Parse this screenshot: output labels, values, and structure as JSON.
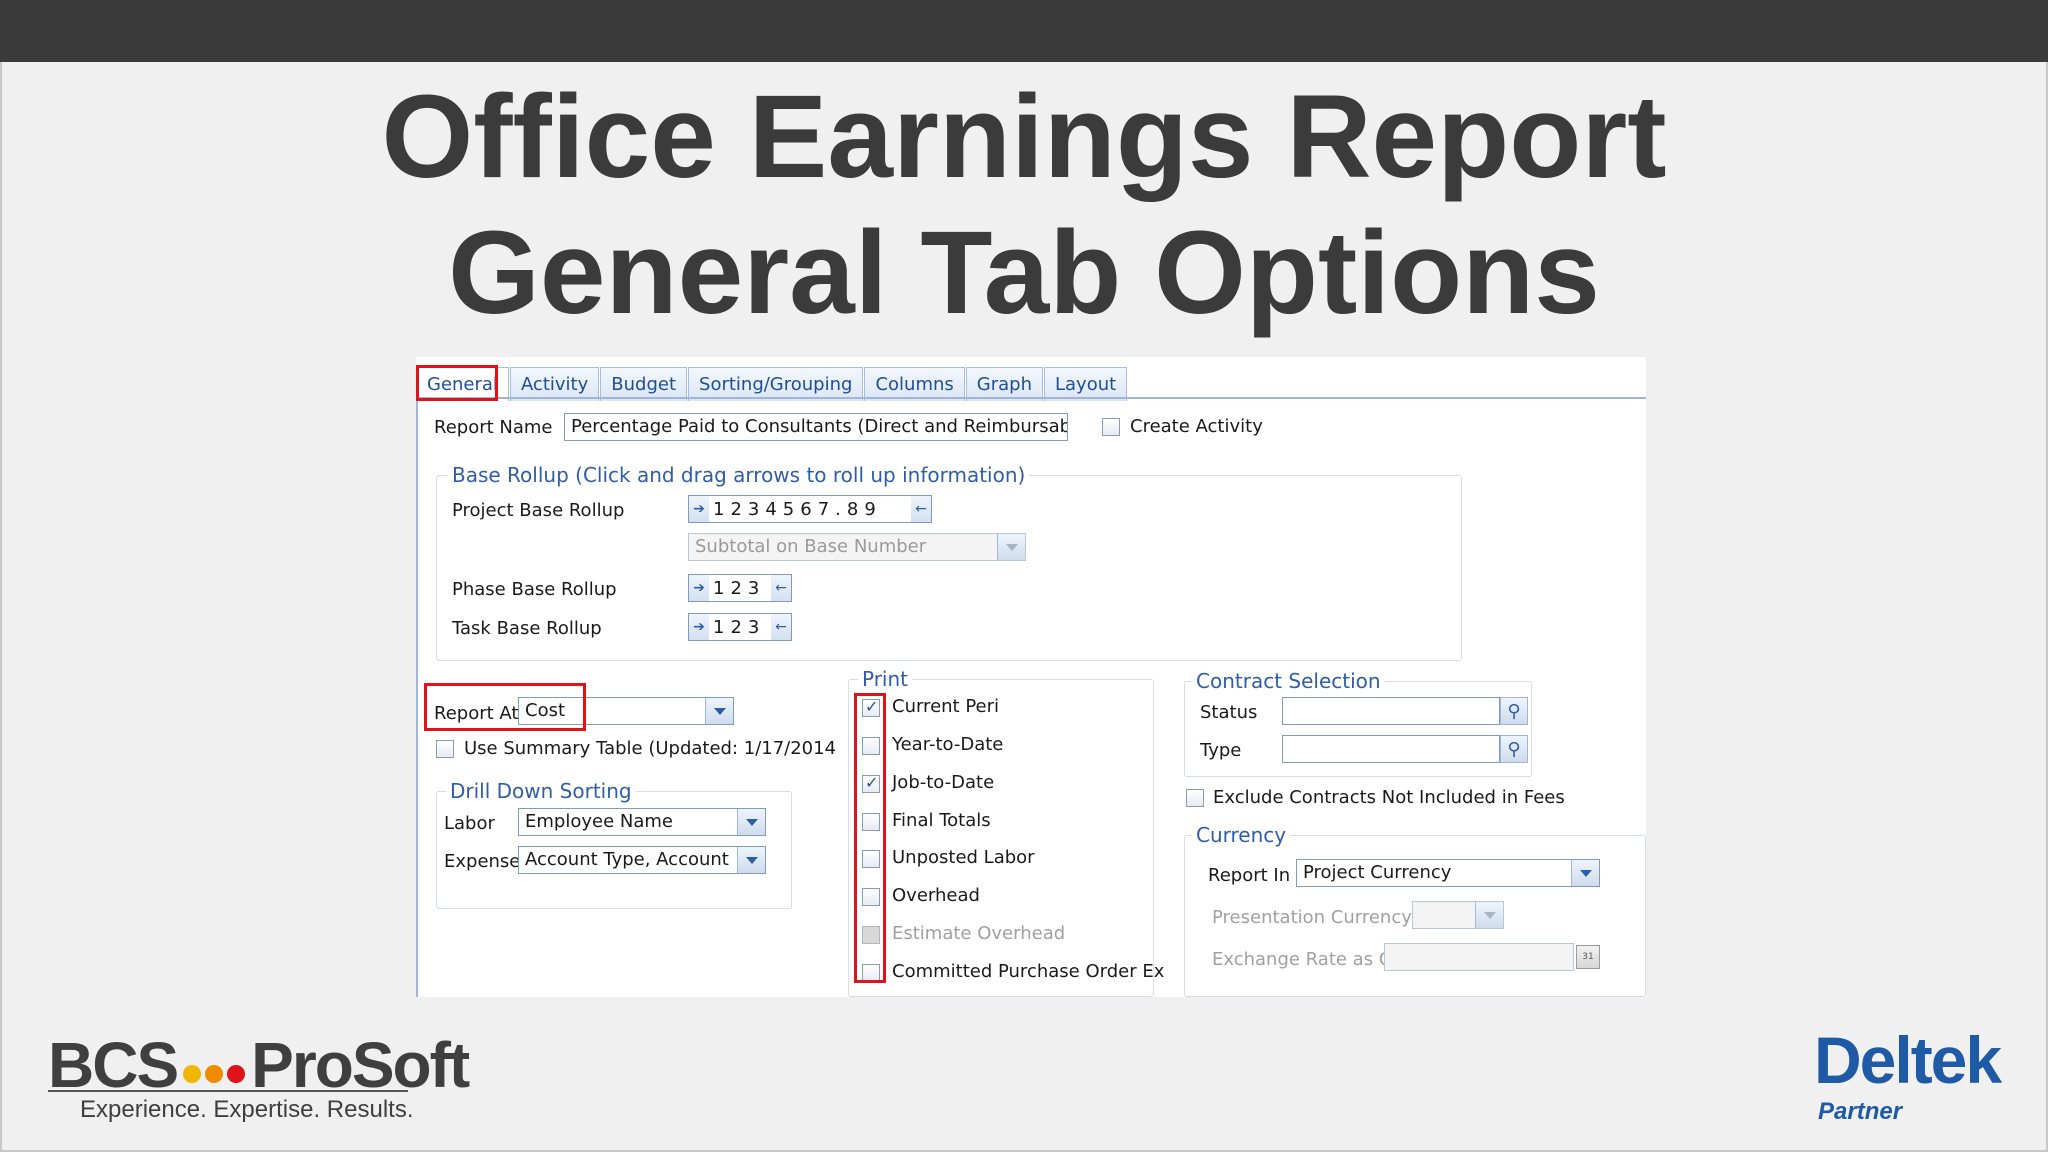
{
  "slide": {
    "title_line1": "Office Earnings Report",
    "title_line2": "General Tab Options"
  },
  "tabs": [
    "General",
    "Activity",
    "Budget",
    "Sorting/Grouping",
    "Columns",
    "Graph",
    "Layout"
  ],
  "general": {
    "report_name_label": "Report Name",
    "report_name_value": "Percentage Paid to Consultants (Direct and Reimbursabl",
    "create_activity_label": "Create Activity",
    "create_activity_checked": false,
    "base_rollup": {
      "group_title": "Base Rollup (Click and drag arrows to roll up information)",
      "project_label": "Project Base Rollup",
      "project_digits": "1234567.89",
      "subtotal_placeholder": "Subtotal on Base Number",
      "phase_label": "Phase Base Rollup",
      "phase_digits": "123",
      "task_label": "Task Base Rollup",
      "task_digits": "123"
    },
    "report_at_label": "Report At",
    "report_at_value": "Cost",
    "use_summary_label": "Use Summary Table (Updated: 1/17/2014",
    "drill_down": {
      "group_title": "Drill Down Sorting",
      "labor_label": "Labor",
      "labor_value": "Employee Name",
      "expense_label": "Expense",
      "expense_value": "Account Type, Account"
    },
    "print": {
      "group_title": "Print",
      "items": [
        {
          "label": "Current Peri",
          "checked": true,
          "disabled": false
        },
        {
          "label": "Year-to-Date",
          "checked": false,
          "disabled": false
        },
        {
          "label": "Job-to-Date",
          "checked": true,
          "disabled": false
        },
        {
          "label": "Final Totals",
          "checked": false,
          "disabled": false
        },
        {
          "label": "Unposted Labor",
          "checked": false,
          "disabled": false
        },
        {
          "label": "Overhead",
          "checked": false,
          "disabled": false
        },
        {
          "label": "Estimate Overhead",
          "checked": false,
          "disabled": true
        },
        {
          "label": "Committed   Purchase   Order Ex",
          "checked": false,
          "disabled": false
        }
      ]
    },
    "contract_selection": {
      "group_title": "Contract Selection",
      "status_label": "Status",
      "status_value": "",
      "type_label": "Type",
      "type_value": ""
    },
    "exclude_contracts_label": "Exclude Contracts Not Included in Fees",
    "currency": {
      "group_title": "Currency",
      "report_in_label": "Report In",
      "report_in_value": "Project Currency",
      "presentation_label": "Presentation Currency",
      "exchange_label": "Exchange Rate as Of",
      "calendar_glyph": "31"
    }
  },
  "logos": {
    "bcs_left": "BCS",
    "bcs_right": "ProSoft",
    "bcs_tagline": "Experience. Expertise. Results.",
    "bcs_dot_colors": [
      "#f2b705",
      "#f08a00",
      "#e0121a"
    ],
    "deltek": "Deltek",
    "partner": "Partner"
  },
  "colors": {
    "highlight": "#e0121a",
    "title": "#3b3b3b",
    "group_title": "#2f5da8",
    "deltek_blue": "#1f5aa6"
  }
}
